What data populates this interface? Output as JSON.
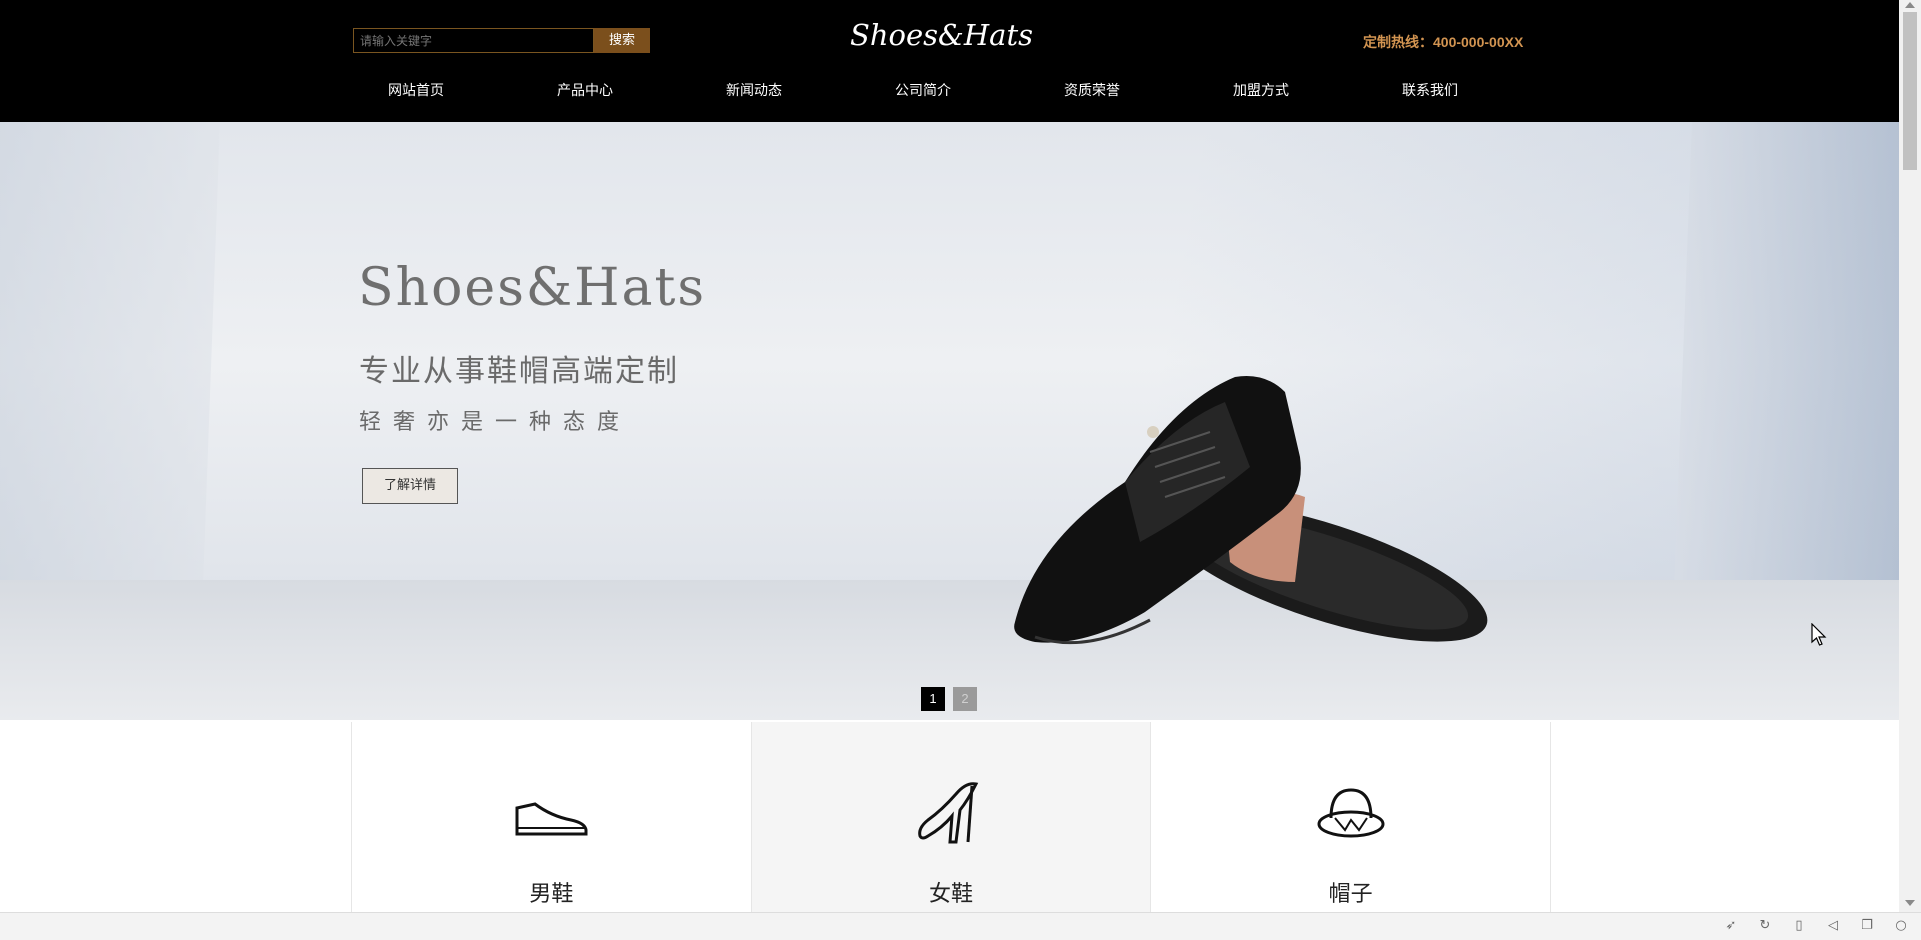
{
  "header": {
    "search_placeholder": "请输入关键字",
    "search_button": "搜索",
    "logo": "Shoes&Hats",
    "hotline": "定制热线：400-000-00XX"
  },
  "nav": [
    {
      "label": "网站首页"
    },
    {
      "label": "产品中心"
    },
    {
      "label": "新闻动态"
    },
    {
      "label": "公司简介"
    },
    {
      "label": "资质荣誉"
    },
    {
      "label": "加盟方式"
    },
    {
      "label": "联系我们"
    }
  ],
  "banner": {
    "title": "Shoes&Hats",
    "subtitle": "专业从事鞋帽高端定制",
    "tagline": "轻奢亦是一种态度",
    "button": "了解详情",
    "pages": [
      "1",
      "2"
    ],
    "active_page": "1"
  },
  "categories": [
    {
      "label": "男鞋",
      "icon": "mens-shoe-icon"
    },
    {
      "label": "女鞋",
      "icon": "high-heel-icon"
    },
    {
      "label": "帽子",
      "icon": "hat-icon"
    }
  ],
  "colors": {
    "header_bg": "#000000",
    "accent": "#7b4f1c",
    "hotline": "#d29451"
  }
}
